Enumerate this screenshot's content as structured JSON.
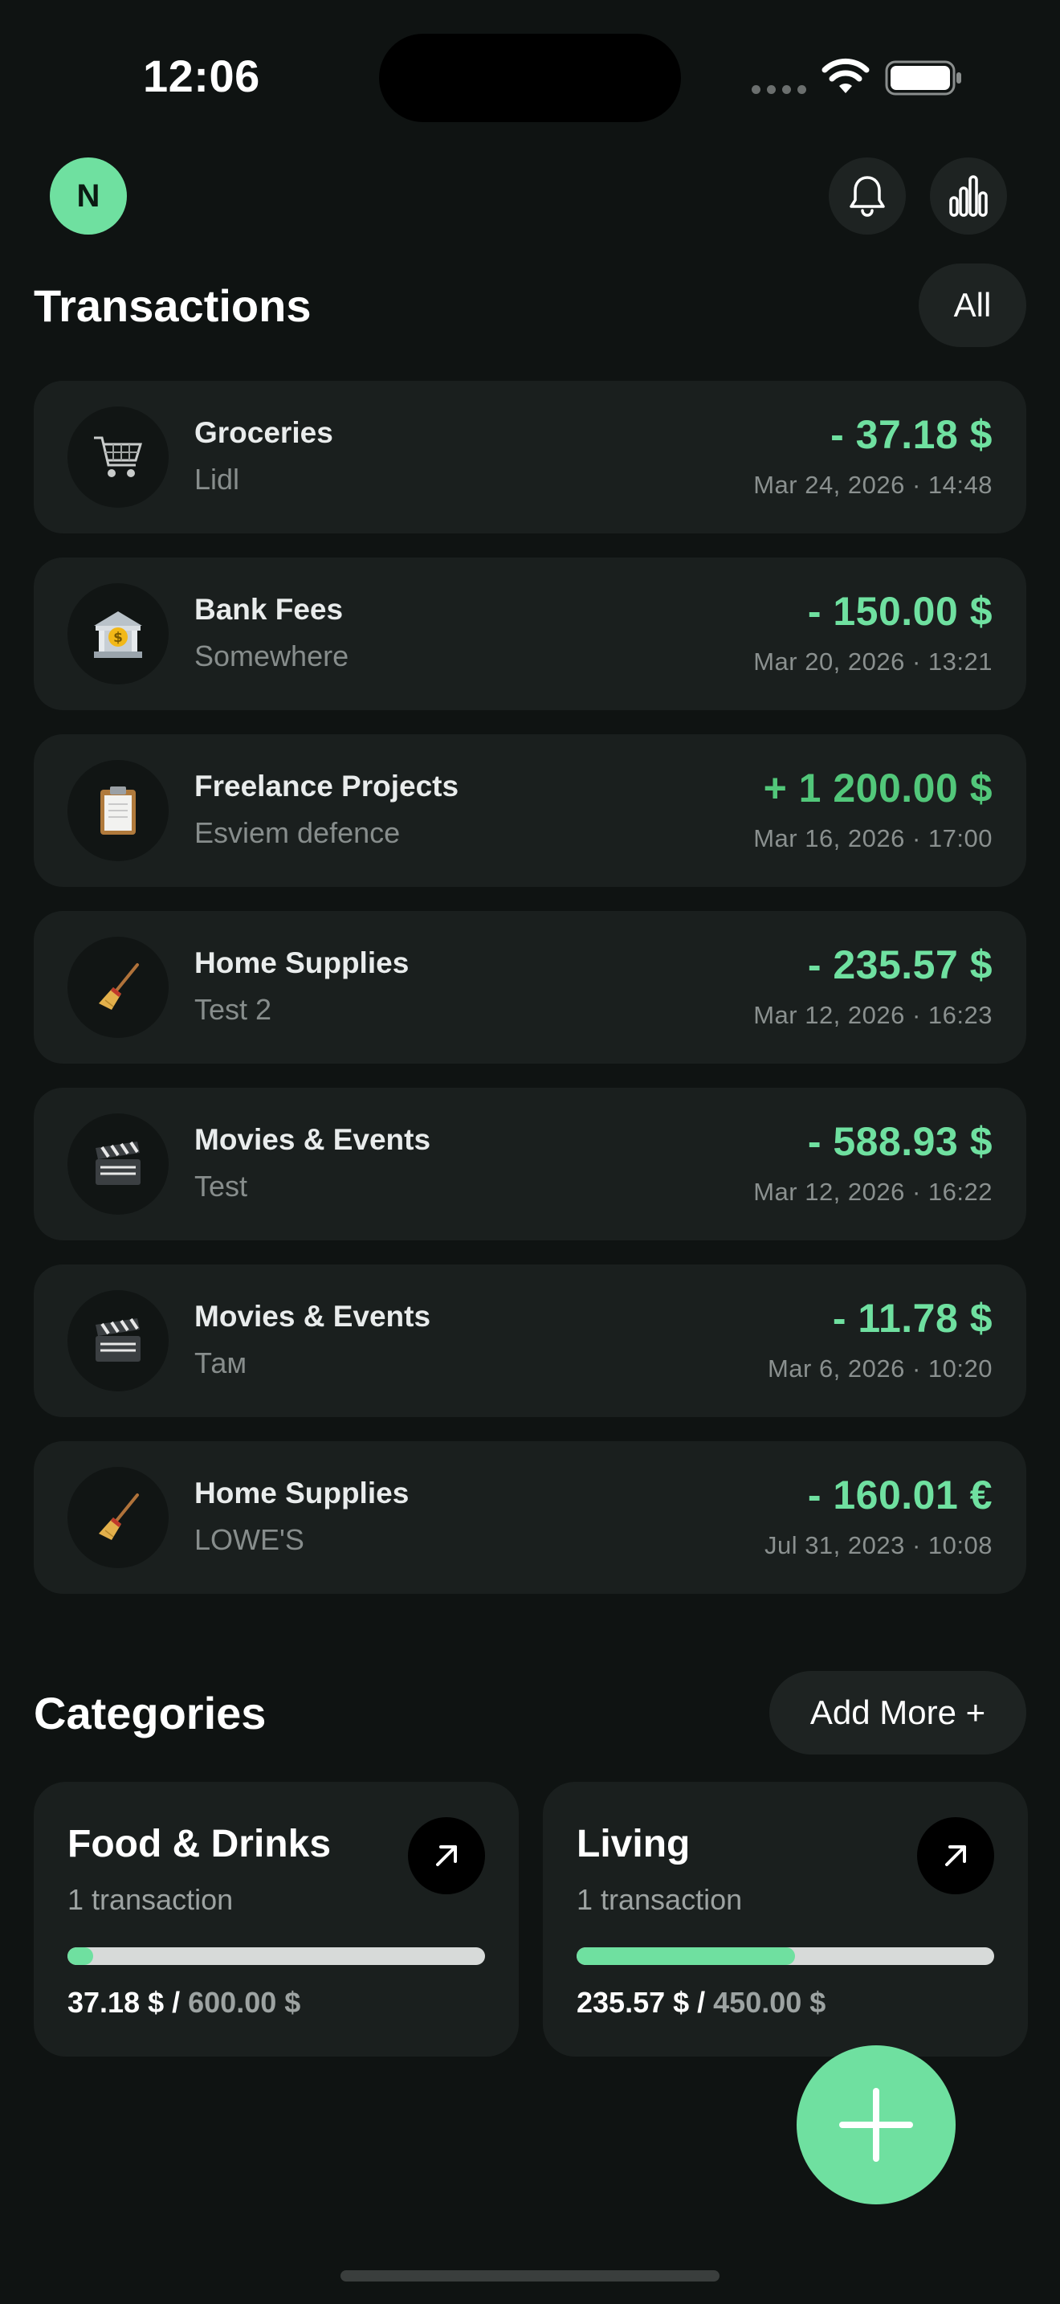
{
  "status_bar": {
    "time": "12:06"
  },
  "header": {
    "avatar_initial": "N"
  },
  "transactions": {
    "title": "Transactions",
    "filter_label": "All",
    "items": [
      {
        "name": "Groceries",
        "merchant": "Lidl",
        "amount": "- 37.18 $",
        "date": "Mar 24, 2026 · 14:48",
        "icon": "shopping-cart-icon"
      },
      {
        "name": "Bank Fees",
        "merchant": "Somewhere",
        "amount": "- 150.00 $",
        "date": "Mar 20, 2026 · 13:21",
        "icon": "bank-icon"
      },
      {
        "name": "Freelance Projects",
        "merchant": "Esviem defence",
        "amount": "+ 1 200.00 $",
        "date": "Mar 16, 2026 · 17:00",
        "icon": "clipboard-icon"
      },
      {
        "name": "Home Supplies",
        "merchant": "Test 2",
        "amount": "- 235.57 $",
        "date": "Mar 12, 2026 · 16:23",
        "icon": "broom-icon"
      },
      {
        "name": "Movies & Events",
        "merchant": "Test",
        "amount": "- 588.93 $",
        "date": "Mar 12, 2026 · 16:22",
        "icon": "clapper-board-icon"
      },
      {
        "name": "Movies & Events",
        "merchant": "Там",
        "amount": "- 11.78 $",
        "date": "Mar 6, 2026 · 10:20",
        "icon": "clapper-board-icon"
      },
      {
        "name": "Home Supplies",
        "merchant": "LOWE'S",
        "amount": "- 160.01 €",
        "date": "Jul 31, 2023 · 10:08",
        "icon": "broom-icon"
      }
    ]
  },
  "categories": {
    "title": "Categories",
    "add_label": "Add More +",
    "items": [
      {
        "name": "Food & Drinks",
        "count": "1 transaction",
        "spent": "37.18 $",
        "separator": " / ",
        "budget": "600.00 $",
        "progress": 0.062
      },
      {
        "name": "Living",
        "count": "1 transaction",
        "spent": "235.57 $",
        "separator": " / ",
        "budget": "450.00 $",
        "progress": 0.523
      }
    ]
  },
  "colors": {
    "accent": "#6fe0a0",
    "background": "#0f1312",
    "card": "#1a1f1e"
  }
}
